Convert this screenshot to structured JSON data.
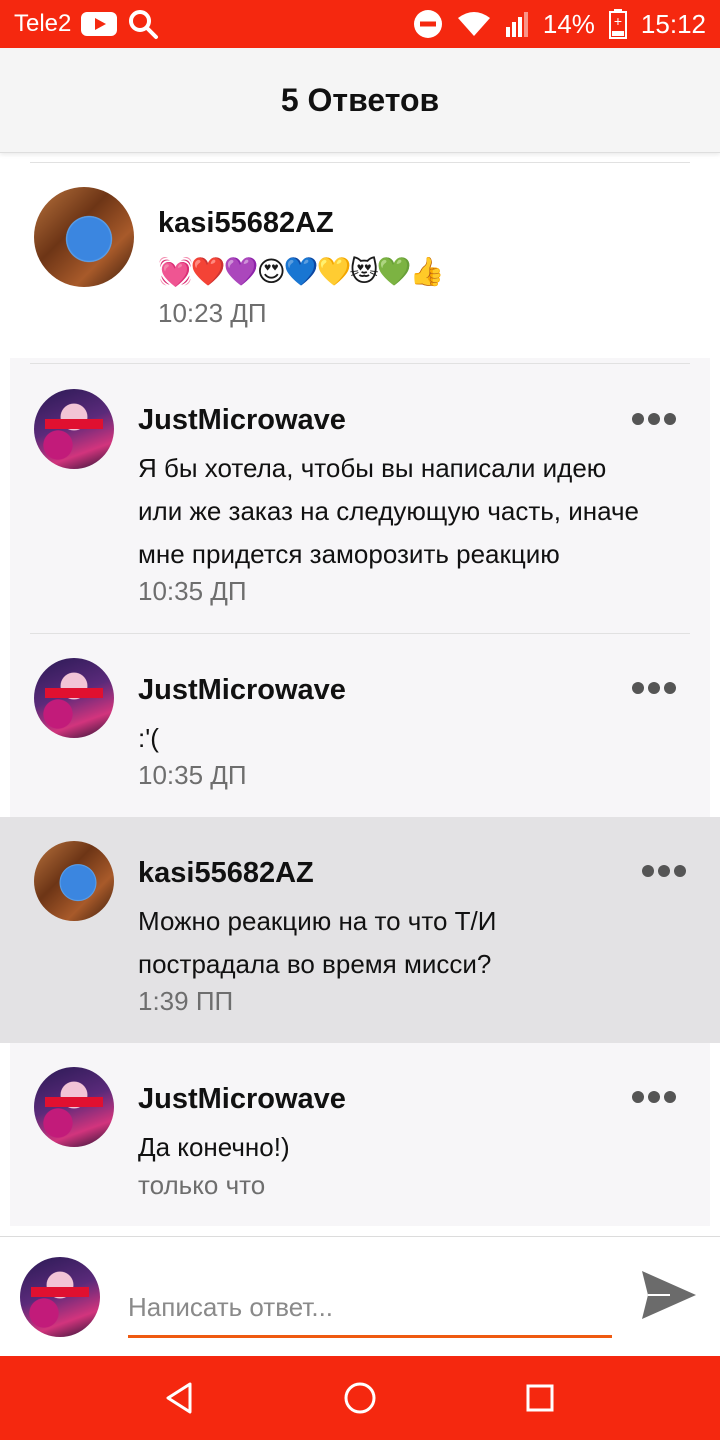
{
  "status_bar": {
    "carrier": "Tele2",
    "battery": "14%",
    "time": "15:12"
  },
  "header": {
    "title": "5 Ответов"
  },
  "parent_comment": {
    "username": "kasi55682AZ",
    "text": "💓❤️💜😍💙💛😻💚👍",
    "time": "10:23 ДП"
  },
  "replies": [
    {
      "username": "JustMicrowave",
      "lines": [
        "Я бы хотела, чтобы вы написали идею",
        "или же заказ на следующую часть, иначе",
        "мне придется заморозить реакцию"
      ],
      "time": "10:35 ДП"
    },
    {
      "username": "JustMicrowave",
      "lines": [
        ":'("
      ],
      "time": "10:35 ДП"
    },
    {
      "username": "kasi55682AZ",
      "lines": [
        "Можно реакцию на то что Т/И",
        "пострадала во время мисси?"
      ],
      "time": "1:39 ПП"
    },
    {
      "username": "JustMicrowave",
      "lines": [
        "Да конечно!)"
      ],
      "time": "только что"
    }
  ],
  "reply_box": {
    "placeholder": "Написать ответ..."
  },
  "colors": {
    "accent": "#f5280f",
    "input_underline": "#ef5a10",
    "highlight_bg": "#e3e2e4"
  },
  "icons": [
    "youtube-icon",
    "search-icon",
    "dnd-icon",
    "wifi-icon",
    "signal-icon",
    "battery-icon",
    "more-icon",
    "send-icon",
    "back-icon",
    "home-icon",
    "recents-icon"
  ]
}
